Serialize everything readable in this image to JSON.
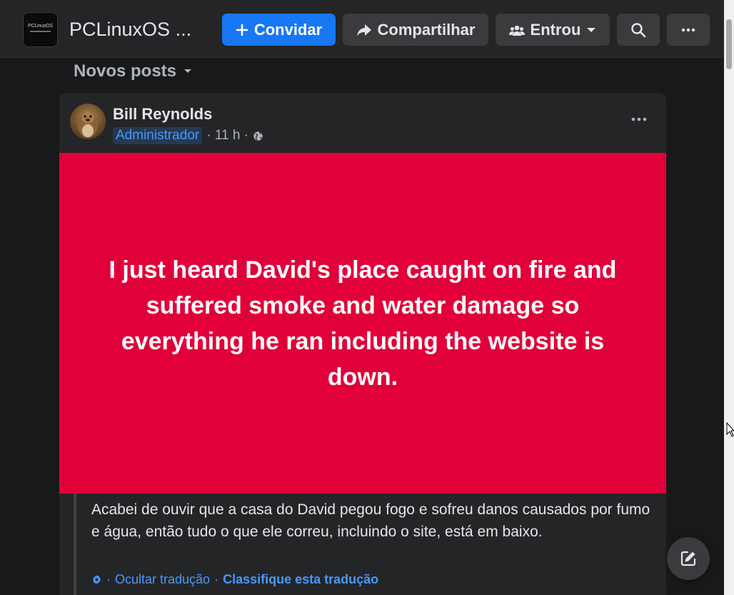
{
  "header": {
    "group_name": "PCLinuxOS ...",
    "thumb_text": "PCLinuxOS",
    "invite_label": "Convidar",
    "share_label": "Compartilhar",
    "joined_label": "Entrou"
  },
  "feed": {
    "sort_label": "Novos posts"
  },
  "post": {
    "author": "Bill Reynolds",
    "role": "Administrador",
    "time": "· 11 h ·",
    "image_text": "I just heard David's place caught on fire and suffered smoke and water damage so everything he ran including the website is down.",
    "translation_text": "Acabei de ouvir que a casa do David pegou fogo e sofreu danos causados por fumo e água, então tudo o que ele correu, incluindo o site, está em baixo.",
    "hide_translation": "Ocultar tradução",
    "separator": "·",
    "rate_translation": "Classifique esta tradução",
    "image_background": "#e1003a"
  },
  "colors": {
    "accent": "#1877f2",
    "link": "#4599ff",
    "surface": "#242526",
    "background": "#18191a"
  }
}
